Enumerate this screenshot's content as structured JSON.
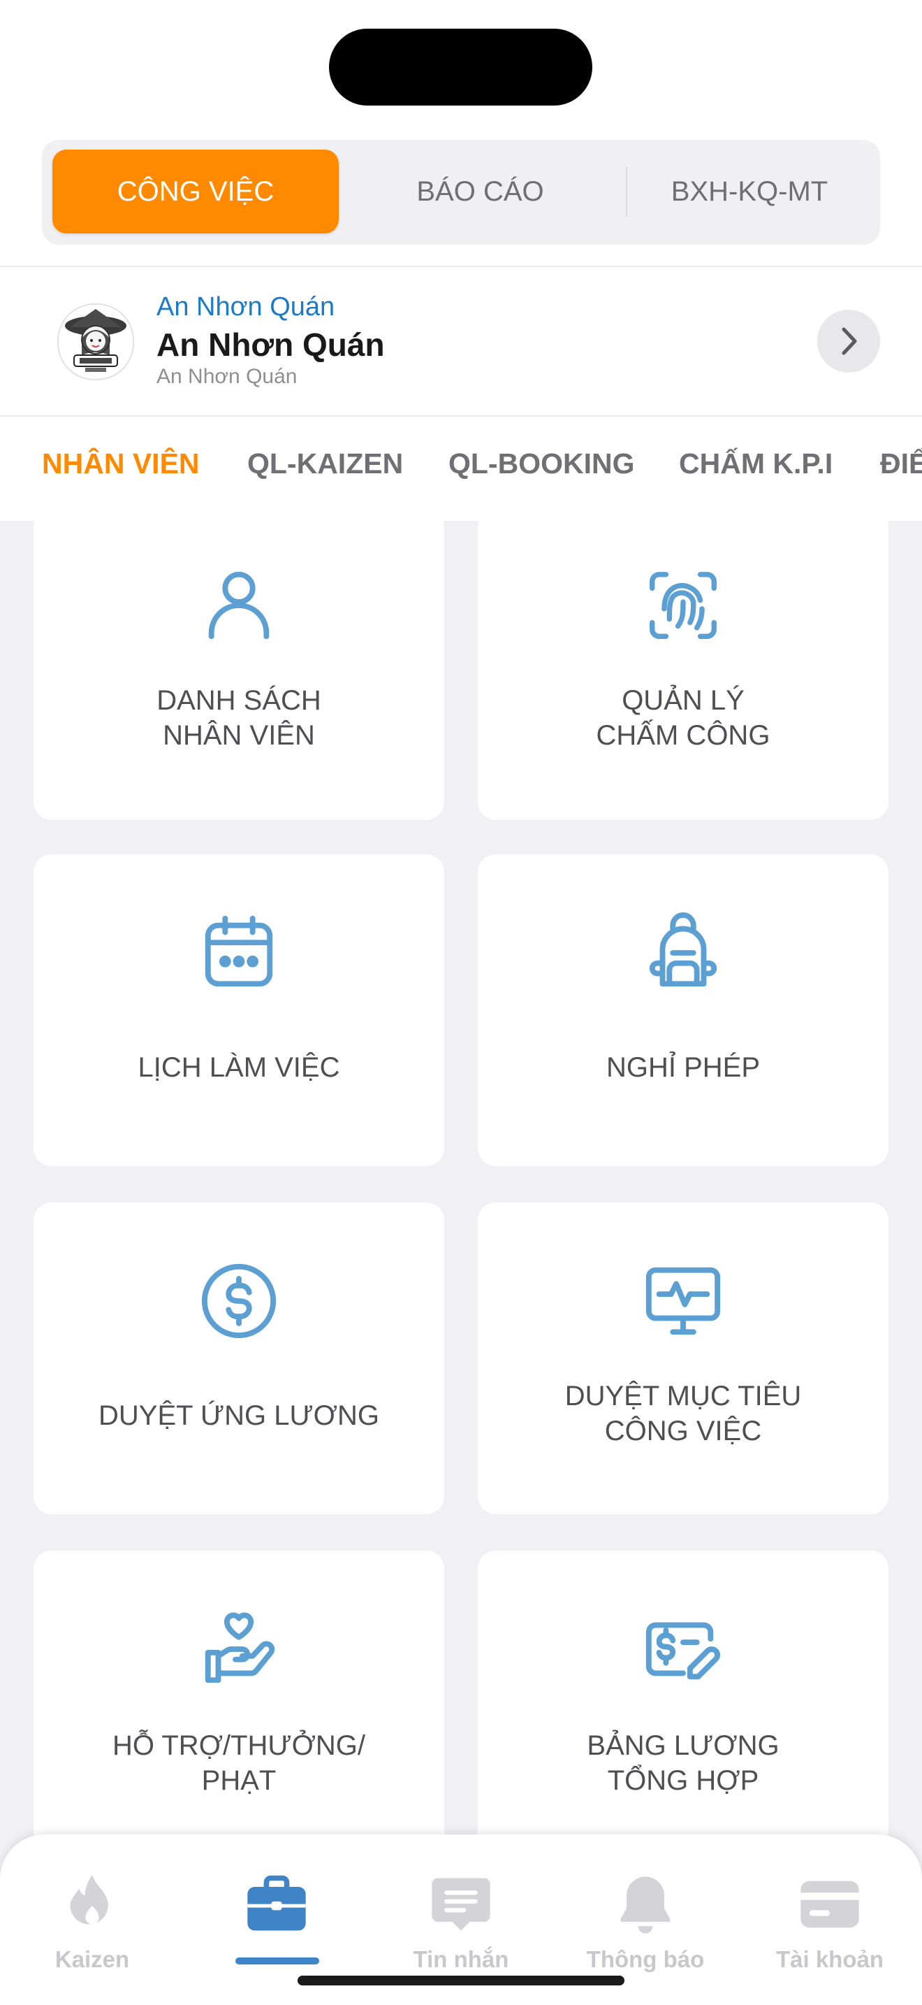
{
  "segments": [
    "CÔNG VIỆC",
    "BÁO CÁO",
    "BXH-KQ-MT"
  ],
  "store": {
    "link": "An Nhơn Quán",
    "name": "An Nhơn Quán",
    "sub": "An Nhơn Quán"
  },
  "tabs": [
    "NHÂN VIÊN",
    "QL-KAIZEN",
    "QL-BOOKING",
    "CHẤM K.P.I",
    "ĐIỂ"
  ],
  "cards": [
    {
      "line1": "DANH SÁCH",
      "line2": "NHÂN VIÊN",
      "icon": "user-icon"
    },
    {
      "line1": "QUẢN LÝ",
      "line2": "CHẤM CÔNG",
      "icon": "fingerprint-icon"
    },
    {
      "line1": "LỊCH LÀM VIỆC",
      "icon": "calendar-icon"
    },
    {
      "line1": "NGHỈ PHÉP",
      "icon": "backpack-icon"
    },
    {
      "line1": "DUYỆT ỨNG LƯƠNG",
      "icon": "dollar-icon"
    },
    {
      "line1": "DUYỆT MỤC TIÊU",
      "line2": "CÔNG VIỆC",
      "icon": "monitor-pulse-icon"
    },
    {
      "line1": "HỖ TRỢ/THƯỞNG/",
      "line2": "PHẠT",
      "icon": "hand-heart-icon"
    },
    {
      "line1": "BẢNG LƯƠNG",
      "line2": "TỔNG HỢP",
      "icon": "payroll-icon"
    }
  ],
  "nav": [
    {
      "label": "Kaizen",
      "icon": "flame-icon"
    },
    {
      "label": "",
      "icon": "briefcase-icon"
    },
    {
      "label": "Tin nhắn",
      "icon": "message-icon"
    },
    {
      "label": "Thông báo",
      "icon": "bell-icon"
    },
    {
      "label": "Tài khoản",
      "icon": "card-icon"
    }
  ],
  "colors": {
    "accent": "#FF8A00",
    "icon_blue": "#5B9FD3",
    "link_blue": "#1C7BC8",
    "nav_active": "#3E84C7",
    "nav_inactive": "#C8C8CC",
    "background": "#F1F1F5"
  }
}
